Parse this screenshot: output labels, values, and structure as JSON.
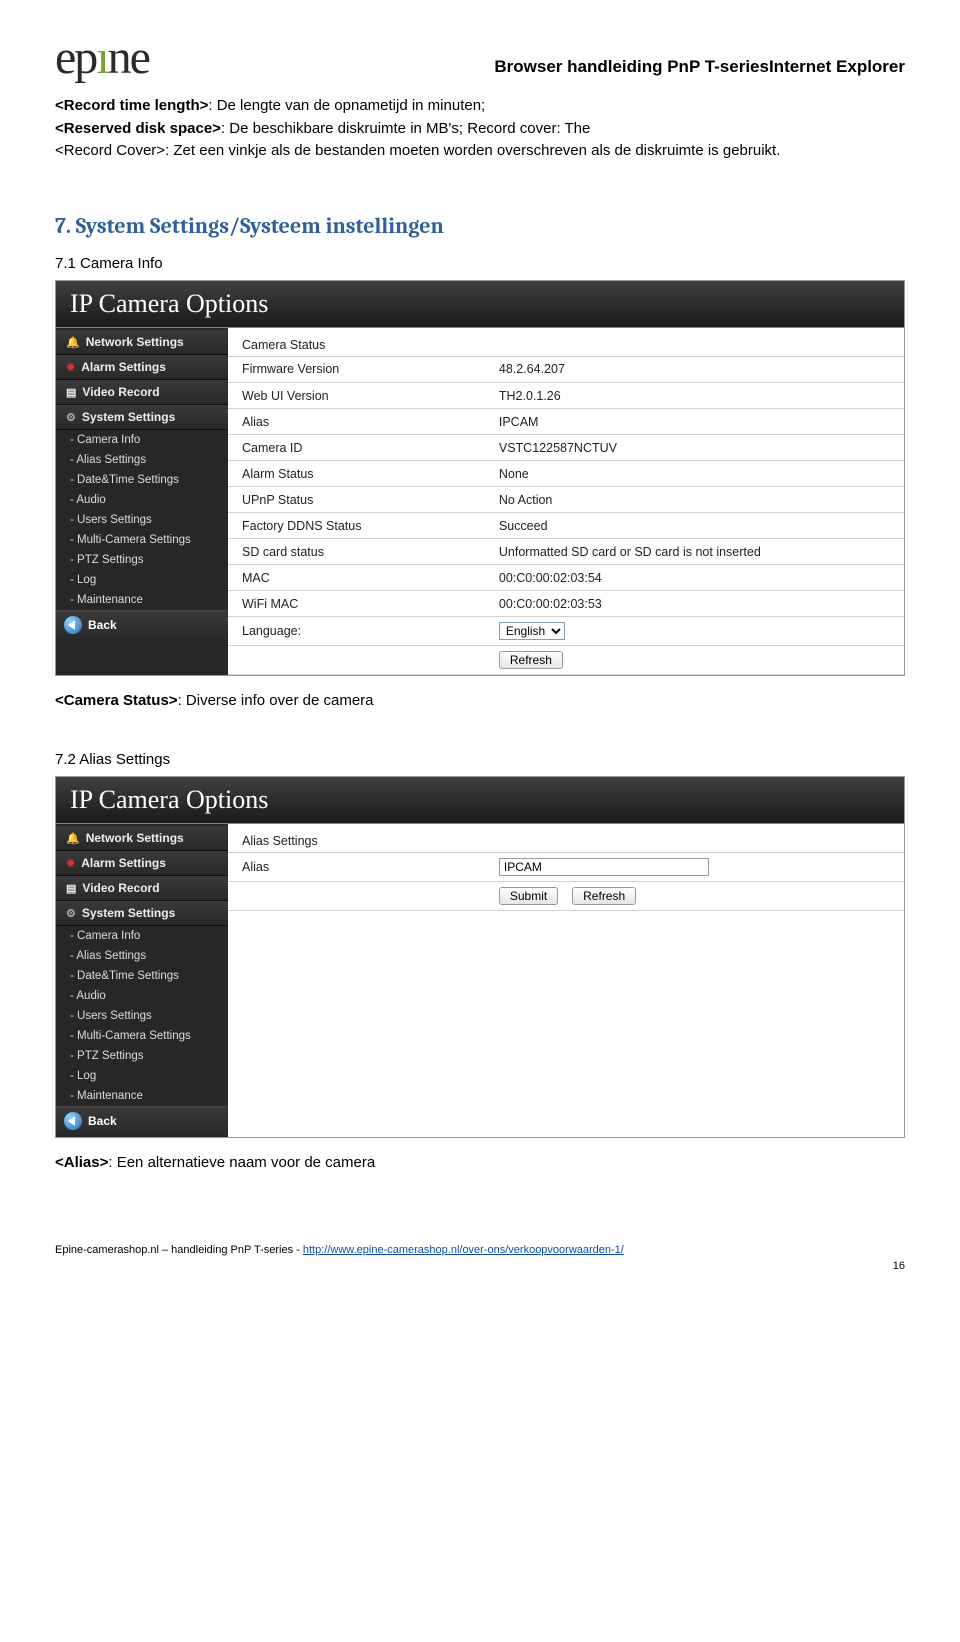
{
  "logo": {
    "text": "epıne"
  },
  "doc_title": "Browser handleiding PnP T-seriesInternet Explorer",
  "intro": {
    "line1_bold": "<Record time length>",
    "line1_rest": ": De lengte van de opnametijd in minuten;",
    "line2_bold": "<Reserved disk space>",
    "line2_rest": ": De beschikbare diskruimte in MB's; Record cover: The",
    "line3": "<Record Cover>: Zet een vinkje als de bestanden moeten worden overschreven als de diskruimte is gebruikt."
  },
  "section7": {
    "heading": "7. System Settings/Systeem instellingen",
    "sub1": "7.1 Camera Info",
    "sub2": "7.2 Alias Settings"
  },
  "panel_title": "IP Camera Options",
  "sidebar": {
    "network": "Network Settings",
    "alarm": "Alarm Settings",
    "video": "Video Record",
    "system": "System Settings",
    "subs": [
      "- Camera Info",
      "- Alias Settings",
      "- Date&Time Settings",
      "- Audio",
      "- Users Settings",
      "- Multi-Camera Settings",
      "- PTZ Settings",
      "- Log",
      "- Maintenance"
    ],
    "back": "Back"
  },
  "camera_status": {
    "header": "Camera Status",
    "rows": [
      {
        "k": "Firmware Version",
        "v": "48.2.64.207"
      },
      {
        "k": "Web UI Version",
        "v": "TH2.0.1.26"
      },
      {
        "k": "Alias",
        "v": "IPCAM"
      },
      {
        "k": "Camera ID",
        "v": "VSTC122587NCTUV"
      },
      {
        "k": "Alarm Status",
        "v": "None"
      },
      {
        "k": "UPnP Status",
        "v": "No Action"
      },
      {
        "k": "Factory DDNS Status",
        "v": "Succeed"
      },
      {
        "k": "SD card status",
        "v": "Unformatted SD card or SD card is not inserted"
      },
      {
        "k": "MAC",
        "v": "00:C0:00:02:03:54"
      },
      {
        "k": "WiFi MAC",
        "v": "00:C0:00:02:03:53"
      }
    ],
    "language_label": "Language:",
    "language_value": "English",
    "refresh": "Refresh"
  },
  "caption1": {
    "bold": "<Camera Status>",
    "rest": ": Diverse info over de camera"
  },
  "alias": {
    "header": "Alias Settings",
    "label": "Alias",
    "value": "IPCAM",
    "submit": "Submit",
    "refresh": "Refresh"
  },
  "caption2": {
    "bold": "<Alias>",
    "rest": ": Een alternatieve naam voor de camera"
  },
  "footer": {
    "text_prefix": "Epine-camerashop.nl – handleiding PnP T-series - ",
    "link": "http://www.epine-camerashop.nl/over-ons/verkoopvoorwaarden-1/"
  },
  "page_number": "16"
}
